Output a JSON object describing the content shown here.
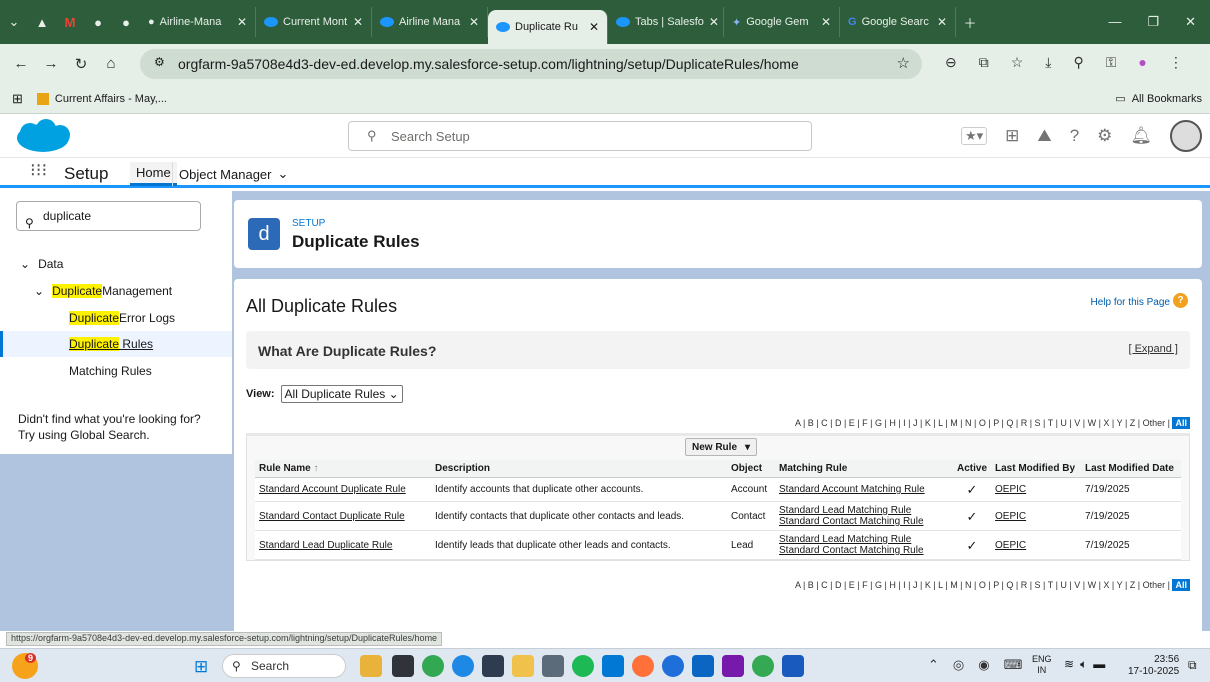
{
  "browser": {
    "tabs": [
      {
        "label": "Airline-Mana"
      },
      {
        "label": "Current Mont"
      },
      {
        "label": "Airline Mana"
      },
      {
        "label": "Duplicate Ru"
      },
      {
        "label": "Tabs | Salesfo"
      },
      {
        "label": "Google Gem"
      },
      {
        "label": "Google Searc"
      }
    ],
    "url": "orgfarm-9a5708e4d3-dev-ed.develop.my.salesforce-setup.com/lightning/setup/DuplicateRules/home",
    "bookmark": "Current Affairs - May,...",
    "all_bookmarks": "All Bookmarks",
    "status_url": "https://orgfarm-9a5708e4d3-dev-ed.develop.my.salesforce-setup.com/lightning/setup/DuplicateRules/home"
  },
  "header": {
    "search_placeholder": "Search Setup"
  },
  "nav": {
    "app": "Setup",
    "home": "Home",
    "object_manager": "Object Manager"
  },
  "sidebar": {
    "quick_find": "duplicate",
    "data": "Data",
    "dm_prefix": "Duplicate",
    "dm_suffix": " Management",
    "items": [
      {
        "hl": "Duplicate",
        "rest": " Error Logs"
      },
      {
        "hl": "Duplicate",
        "rest": " Rules"
      },
      {
        "hl": "",
        "rest": "Matching Rules"
      }
    ],
    "help_text": "Didn't find what you're looking for? Try using Global Search."
  },
  "page_header": {
    "eyebrow": "SETUP",
    "title": "Duplicate Rules",
    "badge": "d"
  },
  "content": {
    "title": "All Duplicate Rules",
    "help": "Help for this Page",
    "what_title": "What Are Duplicate Rules?",
    "expand": "[ Expand ]",
    "view_label": "View:",
    "view_value": "All Duplicate Rules",
    "alpha": "A | B | C | D | E | F | G | H | I | J | K | L | M | N | O | P | Q | R | S | T | U | V | W | X | Y | Z | Other |",
    "alpha_all": "All",
    "new_rule": "New Rule"
  },
  "table": {
    "headers": [
      "Rule Name",
      "Description",
      "Object",
      "Matching Rule",
      "Active",
      "Last Modified By",
      "Last Modified Date"
    ],
    "rows": [
      {
        "name": "Standard Account Duplicate Rule",
        "desc": "Identify accounts that duplicate other accounts.",
        "object": "Account",
        "match1": "Standard Account Matching Rule",
        "match2": "",
        "active": "✓",
        "by": "OEPIC",
        "date": "7/19/2025"
      },
      {
        "name": "Standard Contact Duplicate Rule",
        "desc": "Identify contacts that duplicate other contacts and leads.",
        "object": "Contact",
        "match1": "Standard Lead Matching Rule",
        "match2": "Standard Contact Matching Rule",
        "active": "✓",
        "by": "OEPIC",
        "date": "7/19/2025"
      },
      {
        "name": "Standard Lead Duplicate Rule",
        "desc": "Identify leads that duplicate other leads and contacts.",
        "object": "Lead",
        "match1": "Standard Lead Matching Rule",
        "match2": "Standard Contact Matching Rule",
        "active": "✓",
        "by": "OEPIC",
        "date": "7/19/2025"
      }
    ]
  },
  "taskbar": {
    "search": "Search",
    "lang1": "ENG",
    "lang2": "IN",
    "time": "23:56",
    "date": "17-10-2025",
    "badge": "9"
  }
}
